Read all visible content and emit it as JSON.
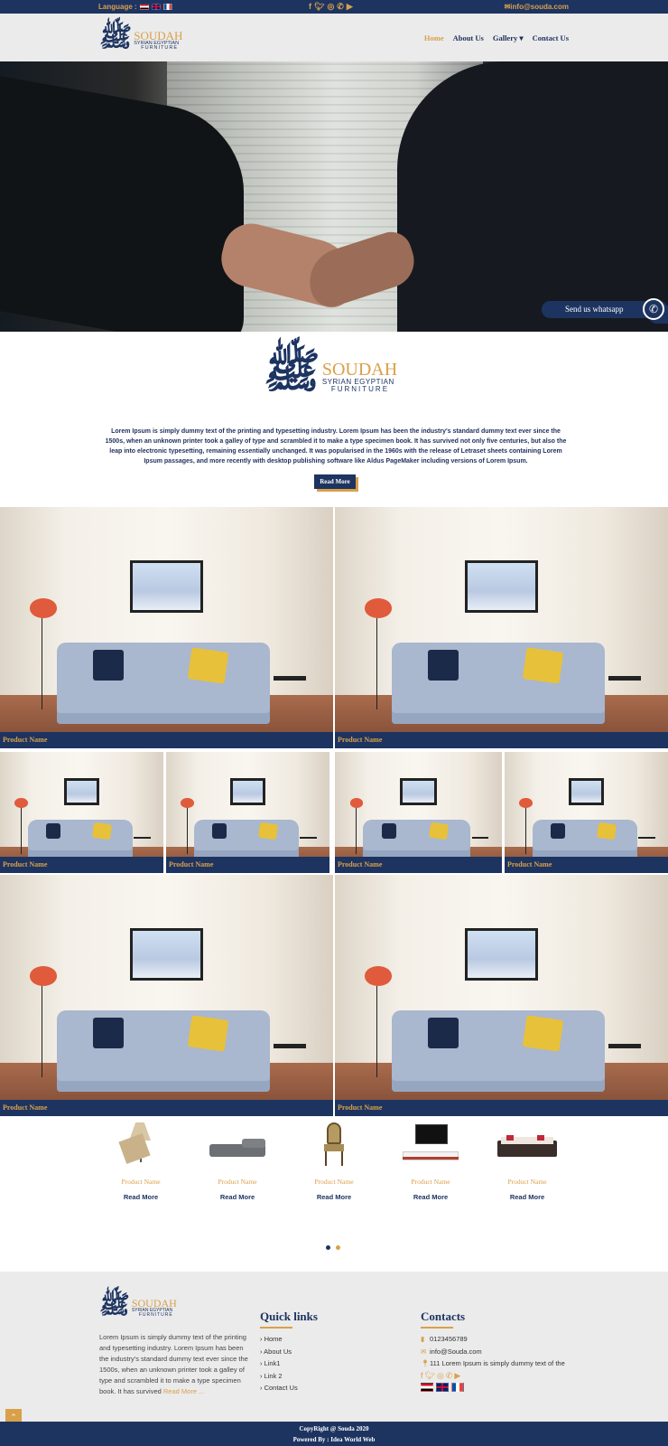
{
  "topbar": {
    "language_label": "Language :",
    "email": "info@souda.com",
    "social_icons": [
      "facebook-icon",
      "twitter-icon",
      "instagram-icon",
      "whatsapp-icon",
      "youtube-icon"
    ]
  },
  "brand": {
    "name": "SOUDAH",
    "subtitle_line1": "SYRIAN EGYPTIAN",
    "subtitle_line2": "FURNITURE"
  },
  "nav": {
    "items": [
      {
        "label": "Home",
        "active": true
      },
      {
        "label": "About Us"
      },
      {
        "label": "Gallery ▾"
      },
      {
        "label": "Contact Us"
      }
    ]
  },
  "whatsapp": {
    "label": "Send us whatsapp"
  },
  "about": {
    "text": "Lorem Ipsum is simply dummy text of the printing and typesetting industry. Lorem Ipsum has been the industry's standard dummy text ever since the 1500s, when an unknown printer took a galley of type and scrambled it to make a type specimen book. It has survived not only five centuries, but also the leap into electronic typesetting, remaining essentially unchanged. It was popularised in the 1960s with the release of Letraset sheets containing Lorem Ipsum passages, and more recently with desktop publishing software like Aldus PageMaker including versions of Lorem Ipsum.",
    "button": "Read More"
  },
  "gallery": {
    "caption": "Product Name"
  },
  "carousel": {
    "items": [
      {
        "name": "Product Name",
        "link": "Read More"
      },
      {
        "name": "Product Name",
        "link": "Read More"
      },
      {
        "name": "Product Name",
        "link": "Read More"
      },
      {
        "name": "Product Name",
        "link": "Read More"
      },
      {
        "name": "Product Name",
        "link": "Read More"
      }
    ]
  },
  "footer": {
    "description": "Lorem Ipsum is simply dummy text of the printing and typesetting industry. Lorem Ipsum has been the industry's standard dummy text ever since the 1500s, when an unknown printer took a galley of type and scrambled it to make a type specimen book. It has survived",
    "read_more": "Read More ...",
    "quick_links_title": "Quick links",
    "quick_links": [
      "Home",
      "About Us",
      "Link1",
      "Link 2",
      "Contact Us"
    ],
    "contacts_title": "Contacts",
    "phone": "0123456789",
    "email": "info@Souda.com",
    "address": "111 Lorem Ipsum is simply dummy text of the"
  },
  "bottom": {
    "copyright": "CopyRight @ Souda 2020",
    "powered": "Powered By : Idea World Web"
  },
  "colors": {
    "navy": "#1d3461",
    "gold": "#d9a04a"
  }
}
